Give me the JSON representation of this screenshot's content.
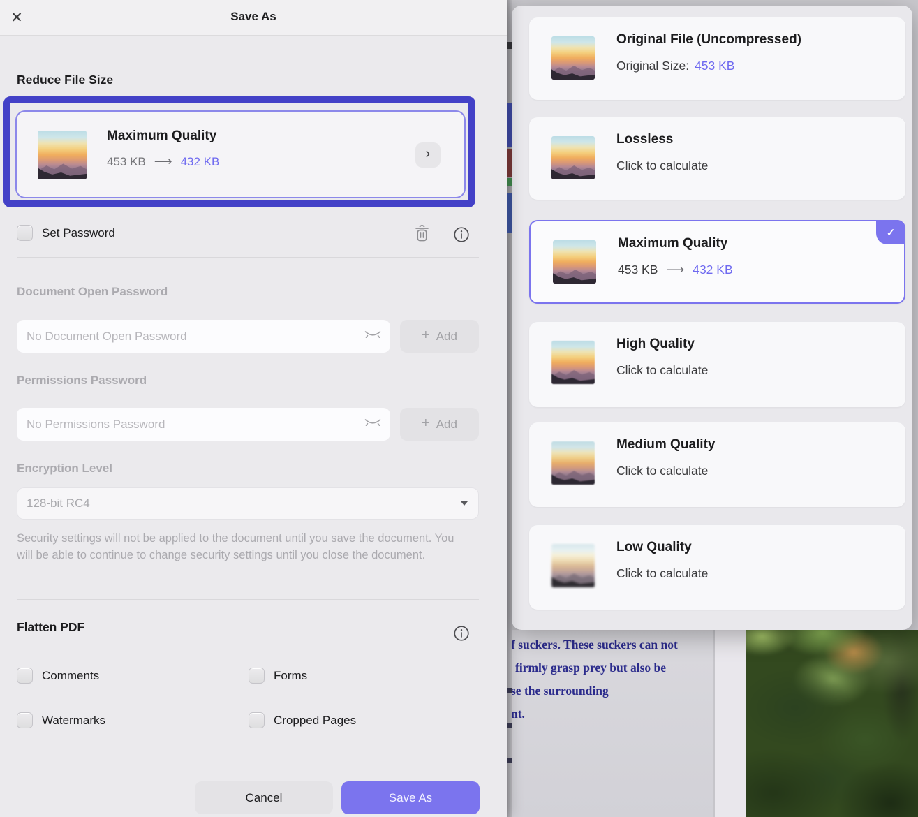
{
  "dialog": {
    "title": "Save As",
    "close_glyph": "✕",
    "reduce_section": {
      "heading": "Reduce File Size",
      "card": {
        "title": "Maximum Quality",
        "size_before": "453 KB",
        "arrow": "⟶",
        "size_after": "432 KB",
        "chevron": "›"
      }
    },
    "password_section": {
      "set_password_label": "Set Password",
      "doc_open_label": "Document Open Password",
      "doc_open_placeholder": "No Document Open Password",
      "permissions_label": "Permissions Password",
      "permissions_placeholder": "No Permissions Password",
      "add_plus": "+",
      "add_label": "Add",
      "encryption_label": "Encryption Level",
      "encryption_value": "128-bit RC4",
      "note": "Security settings will not be applied to the document until you save the document. You will be able to continue to change security settings until you close the document."
    },
    "flatten_section": {
      "heading": "Flatten PDF",
      "options": [
        "Comments",
        "Forms",
        "Watermarks",
        "Cropped Pages"
      ]
    },
    "footer": {
      "cancel_label": "Cancel",
      "save_label": "Save As"
    }
  },
  "quality_panel": {
    "checkmark": "✓",
    "options": [
      {
        "title": "Original File (Uncompressed)",
        "sub_plain": "Original Size:",
        "sub_arrow": "",
        "sub_value": "453 KB",
        "selected": false
      },
      {
        "title": "Lossless",
        "sub_plain": "Click to calculate",
        "sub_arrow": "",
        "sub_value": "",
        "selected": false
      },
      {
        "title": "Maximum Quality",
        "sub_plain": "453 KB",
        "sub_arrow": "⟶",
        "sub_value": "432 KB",
        "selected": true
      },
      {
        "title": "High Quality",
        "sub_plain": "Click to calculate",
        "sub_arrow": "",
        "sub_value": "",
        "selected": false
      },
      {
        "title": "Medium Quality",
        "sub_plain": "Click to calculate",
        "sub_arrow": "",
        "sub_value": "",
        "selected": false
      },
      {
        "title": "Low Quality",
        "sub_plain": "Click to calculate",
        "sub_arrow": "",
        "sub_value": "",
        "selected": false
      }
    ]
  },
  "background_document": {
    "text_lines": [
      "f suckers. These suckers can not",
      "firmly grasp prey but also be",
      "se the surrounding",
      "nt."
    ]
  },
  "colors": {
    "accent": "#7b74ee",
    "annotation_blue": "#4341c7",
    "size_after_blue": "#6f6af0"
  }
}
